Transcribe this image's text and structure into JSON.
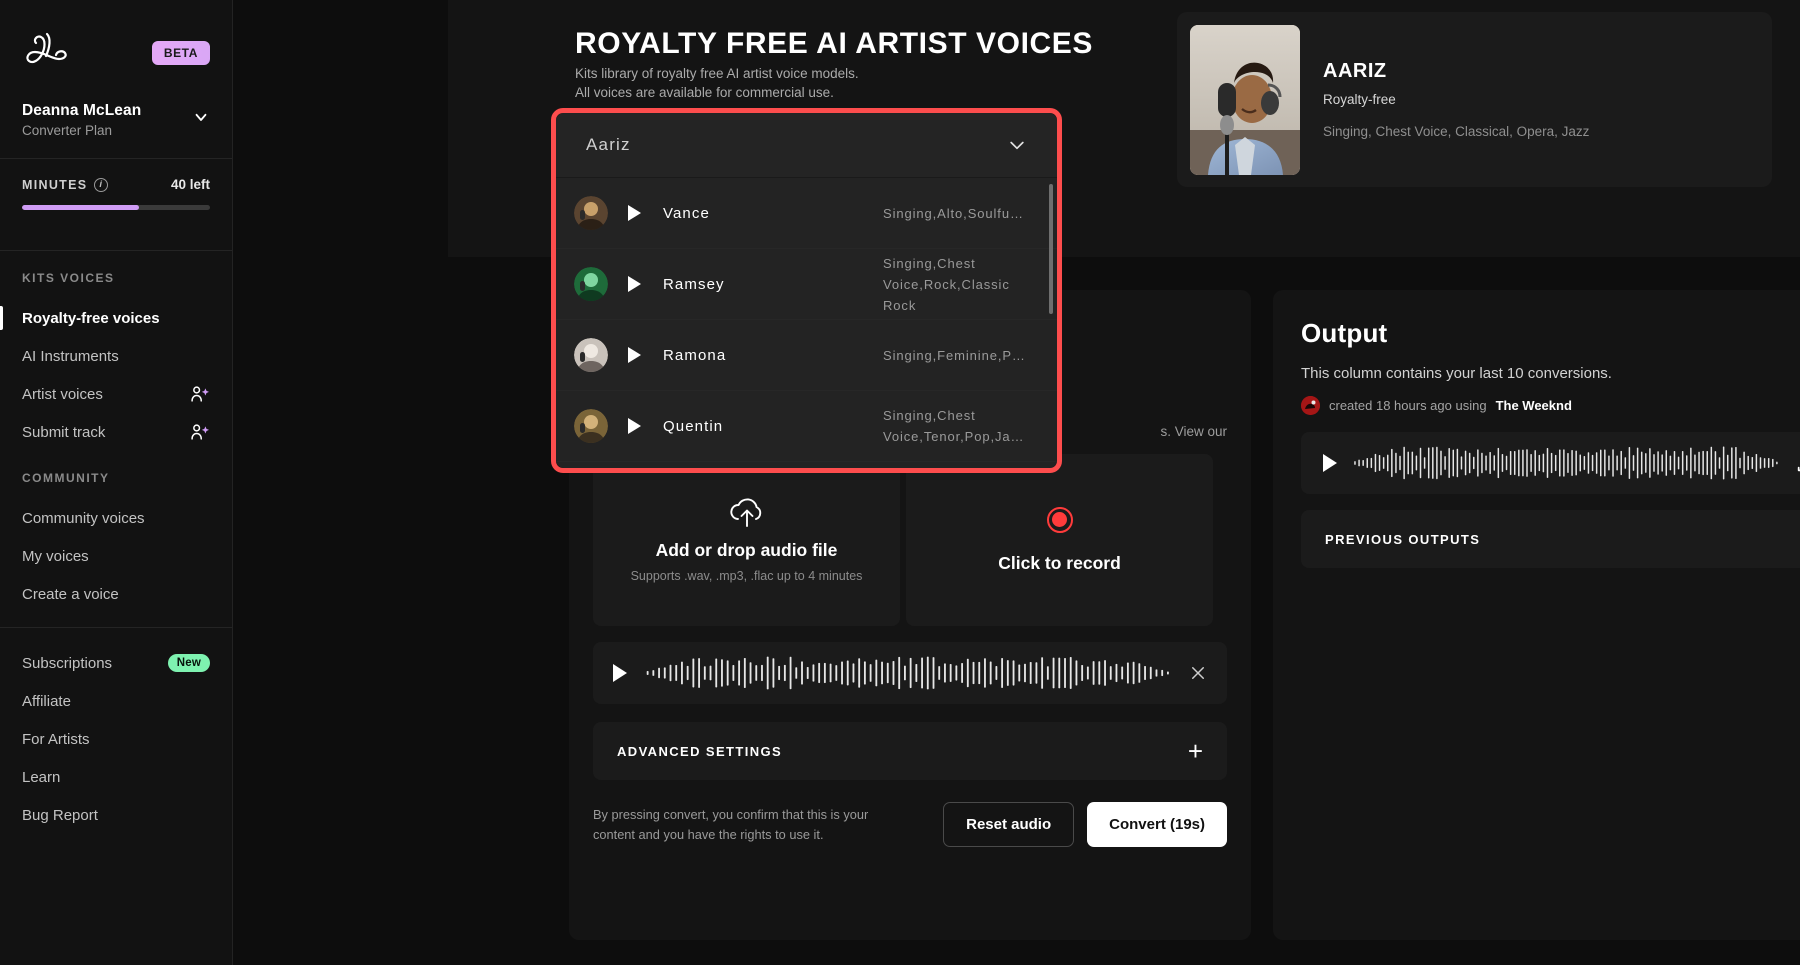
{
  "sidebar": {
    "logo_icon": "kits-ampersand-logo",
    "beta_badge": "BETA",
    "user_name": "Deanna McLean",
    "plan": "Converter Plan",
    "minutes_label": "MINUTES",
    "minutes_left": "40 left",
    "minutes_progress_pct": 62,
    "groups": [
      {
        "title": "KITS VOICES",
        "items": [
          {
            "label": "Royalty-free voices",
            "active": true,
            "badge": null,
            "icon": null
          },
          {
            "label": "AI Instruments",
            "active": false,
            "badge": null,
            "icon": null
          },
          {
            "label": "Artist voices",
            "active": false,
            "badge": null,
            "icon": "person-star-icon"
          },
          {
            "label": "Submit track",
            "active": false,
            "badge": null,
            "icon": "person-star-icon"
          }
        ]
      },
      {
        "title": "COMMUNITY",
        "items": [
          {
            "label": "Community voices",
            "active": false,
            "badge": null,
            "icon": null
          },
          {
            "label": "My voices",
            "active": false,
            "badge": null,
            "icon": null
          },
          {
            "label": "Create a voice",
            "active": false,
            "badge": null,
            "icon": null
          }
        ]
      },
      {
        "title": "",
        "items": [
          {
            "label": "Subscriptions",
            "active": false,
            "badge": "New",
            "icon": null
          },
          {
            "label": "Affiliate",
            "active": false,
            "badge": null,
            "icon": null
          },
          {
            "label": "For Artists",
            "active": false,
            "badge": null,
            "icon": null
          },
          {
            "label": "Learn",
            "active": false,
            "badge": null,
            "icon": null
          },
          {
            "label": "Bug Report",
            "active": false,
            "badge": null,
            "icon": null
          }
        ]
      }
    ]
  },
  "hero": {
    "title": "ROYALTY FREE AI ARTIST VOICES",
    "subtitle_line1": "Kits library of royalty free AI artist voice models.",
    "subtitle_line2": "All voices are available for commercial use."
  },
  "artist_card": {
    "name": "AARIZ",
    "license": "Royalty-free",
    "tags": "Singing, Chest Voice, Classical, Opera, Jazz"
  },
  "dropdown": {
    "selected_value": "Aariz",
    "chevron_icon": "chevron-down-icon",
    "highlighted": true,
    "items": [
      {
        "name": "Vance",
        "tags": "Singing,Alto,Soulfu…"
      },
      {
        "name": "Ramsey",
        "tags": "Singing,Chest Voice,Rock,Classic Rock"
      },
      {
        "name": "Ramona",
        "tags": "Singing,Feminine,P…"
      },
      {
        "name": "Quentin",
        "tags": "Singing,Chest Voice,Tenor,Pop,Ja…"
      }
    ]
  },
  "convert_panel": {
    "note_tail": "s. View our",
    "upload": {
      "icon": "cloud-upload-icon",
      "title": "Add or drop audio file",
      "subtitle": "Supports .wav, .mp3, .flac up to 4 minutes"
    },
    "record": {
      "icon": "record-circle-icon",
      "title": "Click to record"
    },
    "waveform": {
      "play_icon": "play-icon",
      "close_icon": "close-icon"
    },
    "advanced_settings_label": "ADVANCED SETTINGS",
    "advanced_settings_icon": "plus-icon",
    "legal_text": "By pressing convert, you confirm that this is your content and you have the rights to use it.",
    "reset_button": "Reset audio",
    "convert_button": "Convert (19s)"
  },
  "output_panel": {
    "title": "Output",
    "subtitle": "This column contains your last 10 conversions.",
    "created_prefix": "created 18 hours ago using",
    "created_voice": "The Weeknd",
    "player": {
      "play_icon": "play-icon",
      "actions": [
        "download-icon",
        "stem-split-icon",
        "link-icon"
      ]
    },
    "previous_outputs_label": "PREVIOUS OUTPUTS",
    "previous_outputs_icon": "plus-icon"
  },
  "colors": {
    "accent_purple": "#cf9cf5",
    "accent_green": "#7ef2b0",
    "highlight_red": "#fd4d4d",
    "record_red": "#ff3b3b",
    "panel_bg": "#141414",
    "sidebar_bg": "#121212"
  }
}
